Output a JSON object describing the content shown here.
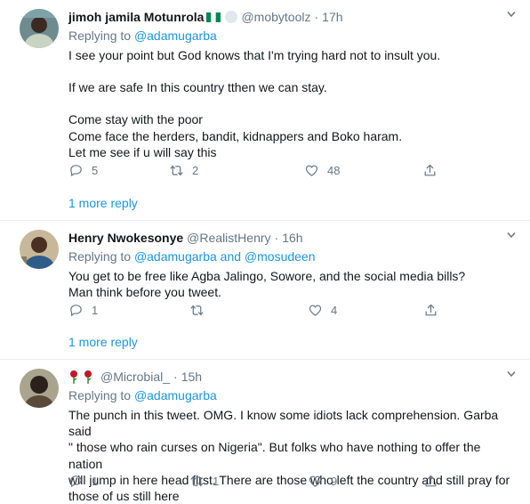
{
  "tweets": [
    {
      "name": "jimoh jamila Motunrola",
      "handle": "@mobytoolz",
      "time": "17h",
      "replying_prefix": "Replying to ",
      "replying_links": "@adamugarba",
      "replying_and": "",
      "replying_link2": "",
      "lines": [
        "I see your point but God knows that I'm trying hard not to insult you.",
        "",
        "If we are safe In this country tthen we can stay.",
        "",
        "Come stay with the poor",
        "Come face the herders, bandit, kidnappers and Boko haram.",
        "Let me see if u will say this"
      ],
      "replies": "5",
      "retweets": "2",
      "likes": "48",
      "more_reply": "1 more reply"
    },
    {
      "name": "Henry Nwokesonye",
      "handle": "@RealistHenry",
      "time": "16h",
      "replying_prefix": "Replying to ",
      "replying_links": "@adamugarba",
      "replying_and": " and ",
      "replying_link2": "@mosudeen",
      "lines": [
        "You get to be free like Agba Jalingo, Sowore, and the social media bills?",
        "Man think before you tweet."
      ],
      "replies": "1",
      "retweets": "",
      "likes": "4",
      "more_reply": "1 more reply"
    },
    {
      "name": "",
      "handle": "@Microbial_",
      "time": "15h",
      "replying_prefix": "Replying to ",
      "replying_links": "@adamugarba",
      "replying_and": "",
      "replying_link2": "",
      "lines": [
        "The punch in this tweet. OMG. I know some idiots lack comprehension. Garba said",
        "\" those who rain curses on Nigeria\". But folks who have nothing to offer the nation",
        "will jump in here head first. There are those who left the country and still pray for",
        "those of us still here"
      ],
      "replies": "1",
      "retweets": "1",
      "likes": "9",
      "more_reply": ""
    }
  ],
  "colors": {
    "link": "#1b95e0",
    "muted": "#657786",
    "text": "#14171a",
    "divider": "#e6ecf0",
    "nigeria_green": "#008751"
  },
  "icons": [
    "reply-icon",
    "retweet-icon",
    "like-icon",
    "share-icon",
    "chevron-down-icon",
    "nigeria-flag-icon",
    "rose-icon"
  ]
}
